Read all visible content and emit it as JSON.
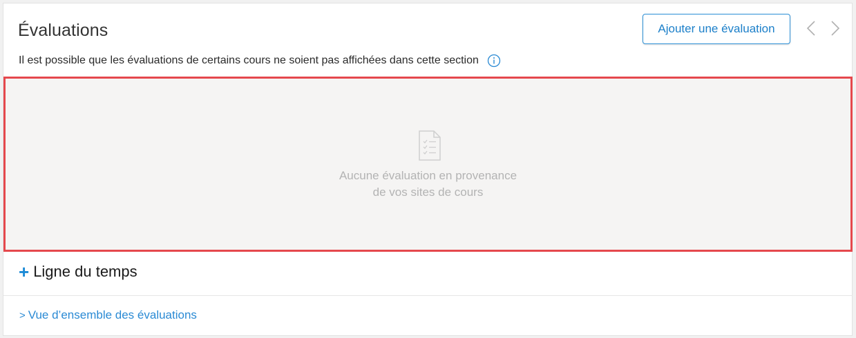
{
  "section": {
    "title": "Évaluations",
    "add_button_label": "Ajouter une évaluation",
    "notice": "Il est possible que les évaluations de certains cours ne soient pas affichées dans cette section"
  },
  "empty_state": {
    "line1": "Aucune évaluation en provenance",
    "line2": "de vos sites de cours"
  },
  "timeline": {
    "plus": "+",
    "label": "Ligne du temps"
  },
  "overview": {
    "chevron": ">",
    "label": "Vue d’ensemble des évaluations"
  },
  "icons": {
    "prev": "chevron-left-icon",
    "next": "chevron-right-icon",
    "info": "info-icon",
    "empty": "checklist-document-icon"
  },
  "colors": {
    "accent": "#1b8ad6",
    "highlight_border": "#e5484d",
    "empty_bg": "#f5f4f3"
  }
}
